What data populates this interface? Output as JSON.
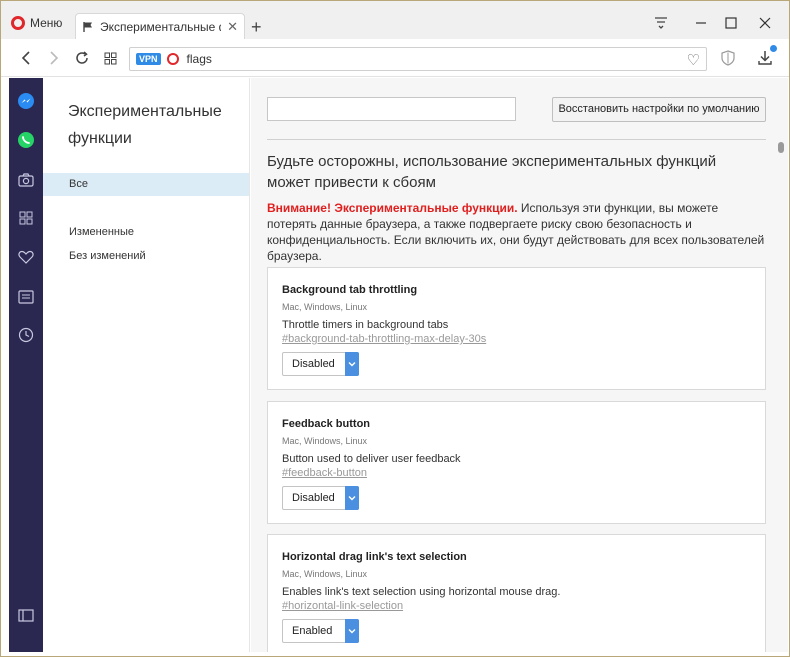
{
  "browser": {
    "menu_label": "Меню",
    "tab_title": "Экспериментальные фун",
    "url": "flags",
    "vpn_label": "VPN"
  },
  "nav": {
    "title": "Экспериментальные функции",
    "items": [
      {
        "label": "Все",
        "active": true
      },
      {
        "label": "Измененные",
        "active": false
      },
      {
        "label": "Без изменений",
        "active": false
      }
    ]
  },
  "search": {
    "value": "",
    "placeholder": ""
  },
  "reset_button": "Восстановить настройки по умолчанию",
  "warning": {
    "title": "Будьте осторожны, использование экспериментальных функций может привести к сбоям",
    "strong": "Внимание! Экспериментальные функции.",
    "text": " Используя эти функции, вы можете потерять данные браузера, а также подвергаете риску свою безопасность и конфиденциальность. Если включить их, они будут действовать для всех пользователей браузера."
  },
  "experiments": [
    {
      "title": "Background tab throttling",
      "platforms": "Mac, Windows, Linux",
      "description": "Throttle timers in background tabs",
      "link": "#background-tab-throttling-max-delay-30s",
      "value": "Disabled"
    },
    {
      "title": "Feedback button",
      "platforms": "Mac, Windows, Linux",
      "description": "Button used to deliver user feedback",
      "link": "#feedback-button",
      "value": "Disabled"
    },
    {
      "title": "Horizontal drag link's text selection",
      "platforms": "Mac, Windows, Linux",
      "description": "Enables link's text selection using horizontal mouse drag.",
      "link": "#horizontal-link-selection",
      "value": "Enabled"
    }
  ],
  "colors": {
    "sidebar": "#2a2850",
    "accent": "#4a8fe0",
    "warning": "#e01f1f",
    "opera_red": "#e0282c"
  }
}
